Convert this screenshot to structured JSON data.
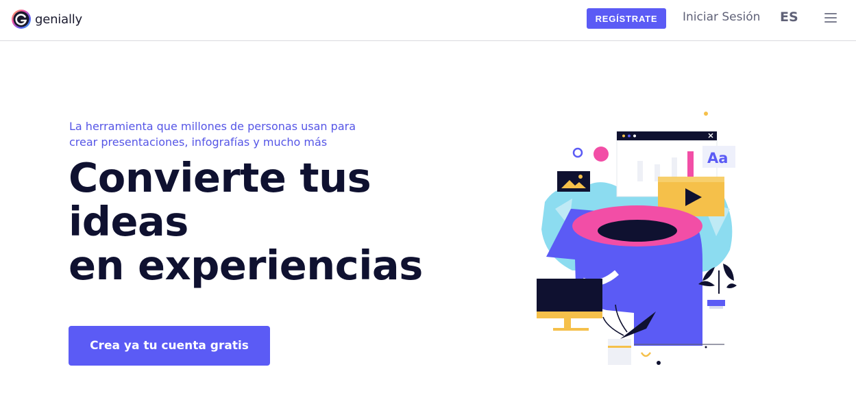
{
  "header": {
    "brand": "genially",
    "register_label": "REGÍSTRATE",
    "login_label": "Iniciar Sesión",
    "language": "ES"
  },
  "hero": {
    "subtitle_line1": "La herramienta que millones de personas usan para",
    "subtitle_line2": "crear presentaciones, infografías y mucho más",
    "headline_line1": "Convierte tus ideas",
    "headline_line2": "en experiencias",
    "cta_label": "Crea ya tu cuenta gratis"
  },
  "illustration": {
    "text_sample": "Aa"
  },
  "colors": {
    "accent": "#5b5bf5",
    "headline": "#0f1130",
    "pink": "#f24ea6",
    "yellow": "#f5c04a",
    "cyan": "#7fd8ee"
  }
}
